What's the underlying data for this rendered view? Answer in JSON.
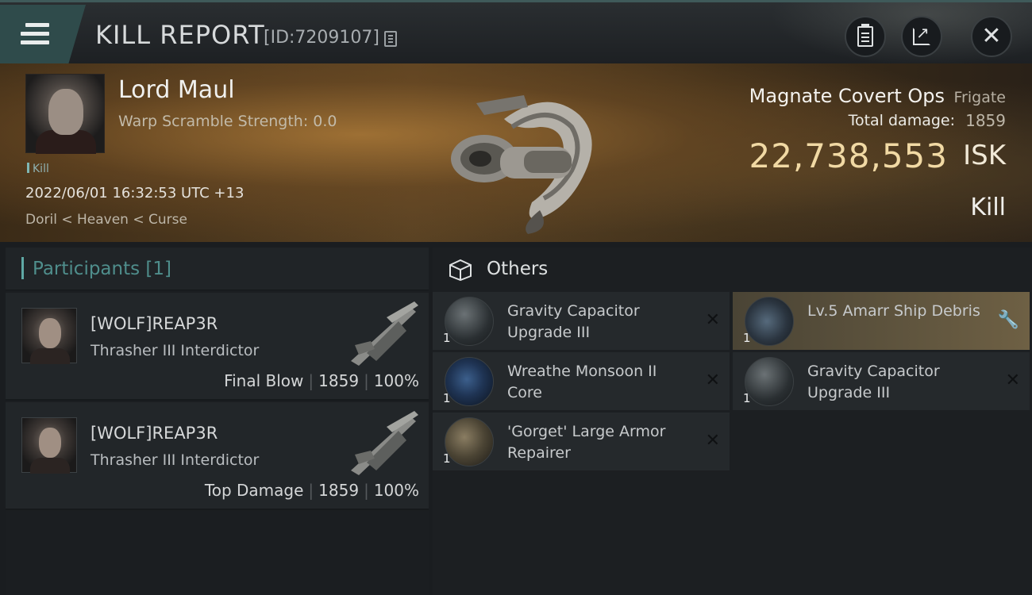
{
  "header": {
    "title": "KILL REPORT",
    "report_id": "[ID:7209107]"
  },
  "victim": {
    "name": "Lord Maul",
    "warp_scramble": "Warp Scramble Strength: 0.0",
    "tag": "Kill",
    "timestamp": "2022/06/01 16:32:53 UTC +13",
    "location": "Doril < Heaven < Curse",
    "ship_name": "Magnate Covert Ops",
    "ship_class": "Frigate",
    "total_damage_label": "Total damage:",
    "total_damage": "1859",
    "isk_value": "22,738,553",
    "isk_label": "ISK",
    "result": "Kill"
  },
  "participants": {
    "title": "Participants [1]",
    "rows": [
      {
        "name": "[WOLF]REAP3R",
        "ship": "Thrasher III Interdictor",
        "role": "Final Blow",
        "damage": "1859",
        "percent": "100%"
      },
      {
        "name": "[WOLF]REAP3R",
        "ship": "Thrasher III Interdictor",
        "role": "Top Damage",
        "damage": "1859",
        "percent": "100%"
      }
    ]
  },
  "others": {
    "title": "Others",
    "items": [
      {
        "name": "Gravity Capacitor Upgrade III",
        "qty": "1",
        "icon": "capacitor-upgrade-icon",
        "status": "destroyed"
      },
      {
        "name": "Lv.5 Amarr Ship Debris",
        "qty": "1",
        "icon": "ship-debris-icon",
        "status": "dropped"
      },
      {
        "name": "Wreathe Monsoon II Core",
        "qty": "1",
        "icon": "core-icon",
        "status": "destroyed"
      },
      {
        "name": "Gravity Capacitor Upgrade III",
        "qty": "1",
        "icon": "capacitor-upgrade-icon",
        "status": "destroyed"
      },
      {
        "name": "'Gorget' Large Armor Repairer",
        "qty": "1",
        "icon": "armor-repairer-icon",
        "status": "destroyed"
      }
    ]
  },
  "colors": {
    "accent": "#5fa9a5",
    "isk": "#f1d9a4",
    "highlight": "#6e6044",
    "wrench": "#f2c25e"
  }
}
